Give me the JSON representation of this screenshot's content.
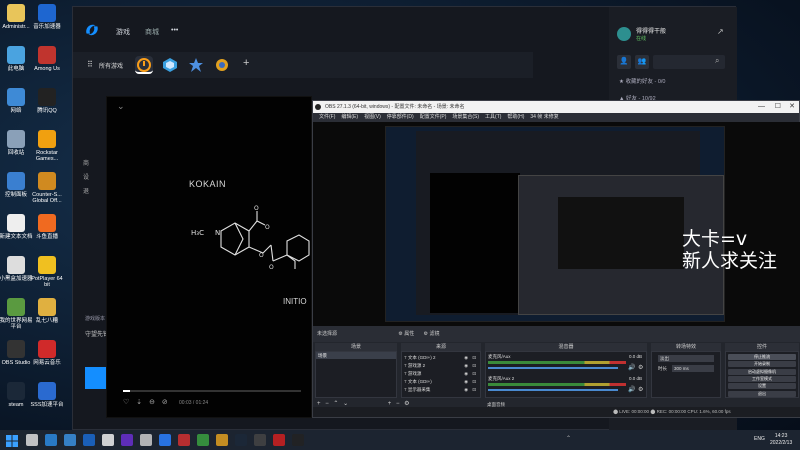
{
  "colors": {
    "accent": "#148eff",
    "obs_bg": "#1f2127",
    "battlenet_bg": "#15181f",
    "taskbar": "#1c2430",
    "meter_green": "#3a8a3a",
    "meter_red": "#c03030"
  },
  "desktop_icons": [
    {
      "label": "Administr...",
      "color": "#e8c55a"
    },
    {
      "label": "音乐加速器",
      "color": "#1e66d0"
    },
    {
      "label": "此电脑",
      "color": "#4aa3e0"
    },
    {
      "label": "Among Us",
      "color": "#c0342e"
    },
    {
      "label": "网络",
      "color": "#3e8ad6"
    },
    {
      "label": "腾讯QQ",
      "color": "#222"
    },
    {
      "label": "回收站",
      "color": "#8aa0b8"
    },
    {
      "label": "Rockstar Games...",
      "color": "#f0a010"
    },
    {
      "label": "控制面板",
      "color": "#3a7fd0"
    },
    {
      "label": "Counter-S... Global Off...",
      "color": "#d08a20"
    },
    {
      "label": "新建文本文档",
      "color": "#eee"
    },
    {
      "label": "斗鱼直播",
      "color": "#f06a20"
    },
    {
      "label": "小黑盒加速器",
      "color": "#ddd"
    },
    {
      "label": "PotPlayer 64 bit",
      "color": "#f0c020"
    },
    {
      "label": "我的世界网易平台",
      "color": "#5a9a40"
    },
    {
      "label": "乱七八糟",
      "color": "#e0b040"
    },
    {
      "label": "OBS Studio",
      "color": "#333"
    },
    {
      "label": "网易云音乐",
      "color": "#d02a2a"
    },
    {
      "label": "steam",
      "color": "#1b2838"
    },
    {
      "label": "SSS加速平台",
      "color": "#2a6ad0"
    }
  ],
  "battlenet": {
    "tab_games": "游戏",
    "tab_shop": "商城",
    "more": "•••",
    "all_games": "所有游戏",
    "add": "+",
    "user_name": "得得得干般",
    "user_status": "在线",
    "friends_header": "★ 收藏的好友 - 0/0",
    "friends_section": "▲ 好友 - 10/92",
    "left_items": [
      "商",
      "设",
      "退"
    ],
    "left_label": "游戏版本",
    "left_label2": "守望先锋"
  },
  "player": {
    "chevron": "⌄",
    "text_kokain": "KOKAIN",
    "text_initio": "INITIO",
    "methyl": "H3C — N",
    "time": "00:03 / 01:24",
    "controls": [
      "♡",
      "⇣",
      "⊖",
      "⊘"
    ]
  },
  "obs": {
    "title": "OBS 27.1.3 (64-bit, windows) - 配置文件: 未命名 - 场景: 未命名",
    "menu": [
      "文件(F)",
      "编辑(E)",
      "视图(V)",
      "停靠部件(D)",
      "配置文件(P)",
      "场景集合(S)",
      "工具(T)",
      "帮助(H)",
      "34 帧 未修复"
    ],
    "unselected_source": "未选择源",
    "properties": "⚙ 属性",
    "filters": "⚙ 滤镜",
    "docks": {
      "scenes": "场景",
      "sources": "来源",
      "mixer": "混音器",
      "transitions": "转场特效",
      "controls": "控件"
    },
    "scene_item": "场景",
    "sources": [
      "文本 (GDI+) 2",
      "游戏源 2",
      "游戏源",
      "文本 (GDI+)",
      "显示器采集"
    ],
    "mixer": [
      {
        "name": "麦克风/Aux",
        "level": "0.0 dB"
      },
      {
        "name": "麦克风/Aux 2",
        "level": "0.0 dB"
      },
      {
        "name": "桌面音频",
        "level": ""
      }
    ],
    "transition": "淡出",
    "duration_label": "时长",
    "duration_value": "300 ms",
    "controls": [
      "停止推流",
      "开始录制",
      "启动虚拟摄像机",
      "工作室模式",
      "设置",
      "退出"
    ],
    "status": "⬤ LIVE: 00:00:00   ⬤ REC: 00:00:00   CPU: 1.6%, 60.00 fps"
  },
  "overlay": {
    "line1": "大卡=v",
    "line2": "新人求关注"
  },
  "taskbar": {
    "lang": "ENG",
    "time": "14:23",
    "date": "2022/2/13"
  }
}
